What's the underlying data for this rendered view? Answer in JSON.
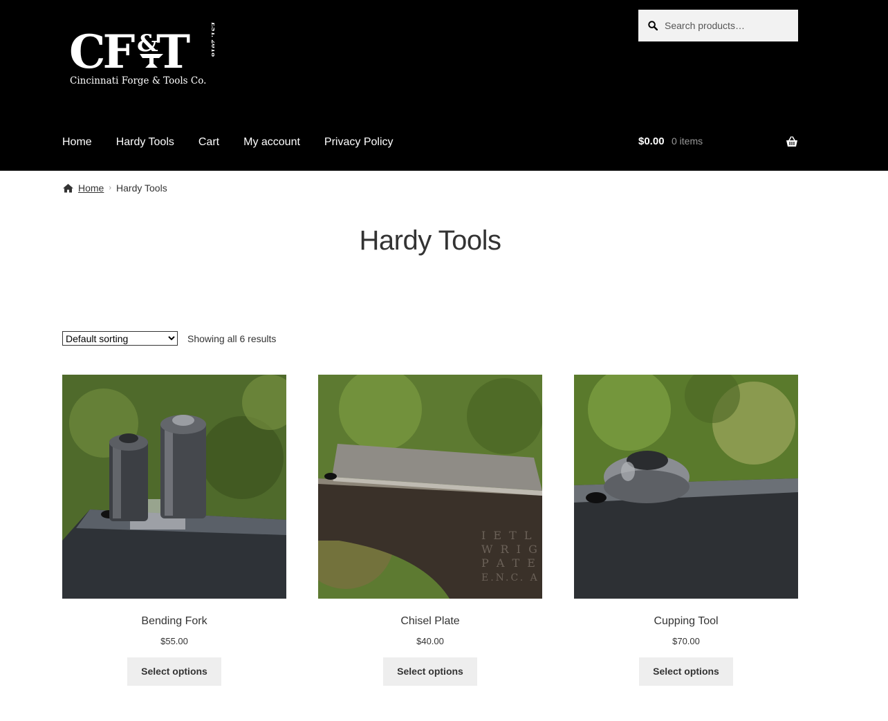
{
  "header": {
    "logo_mark": "CF&T",
    "logo_est": "EST. 2018",
    "logo_name": "Cincinnati Forge & Tools Co.",
    "search_placeholder": "Search products…",
    "nav": [
      "Home",
      "Hardy Tools",
      "Cart",
      "My account",
      "Privacy Policy"
    ],
    "cart_amount": "$0.00",
    "cart_items": "0 items",
    "icons": [
      "search-icon",
      "basket-icon"
    ]
  },
  "breadcrumb": {
    "home": "Home",
    "current": "Hardy Tools",
    "icons": [
      "home-icon",
      "chevron-right-icon"
    ]
  },
  "page": {
    "title": "Hardy Tools"
  },
  "toolbar": {
    "sort_selected": "Default sorting",
    "result_count": "Showing all 6 results"
  },
  "products": [
    {
      "name": "Bending Fork",
      "price": "$55.00",
      "button": "Select options"
    },
    {
      "name": "Chisel Plate",
      "price": "$40.00",
      "button": "Select options"
    },
    {
      "name": "Cupping Tool",
      "price": "$70.00",
      "button": "Select options"
    }
  ],
  "colors": {
    "header_bg": "#000000",
    "button_bg": "#eeeeee",
    "text": "#333333"
  }
}
